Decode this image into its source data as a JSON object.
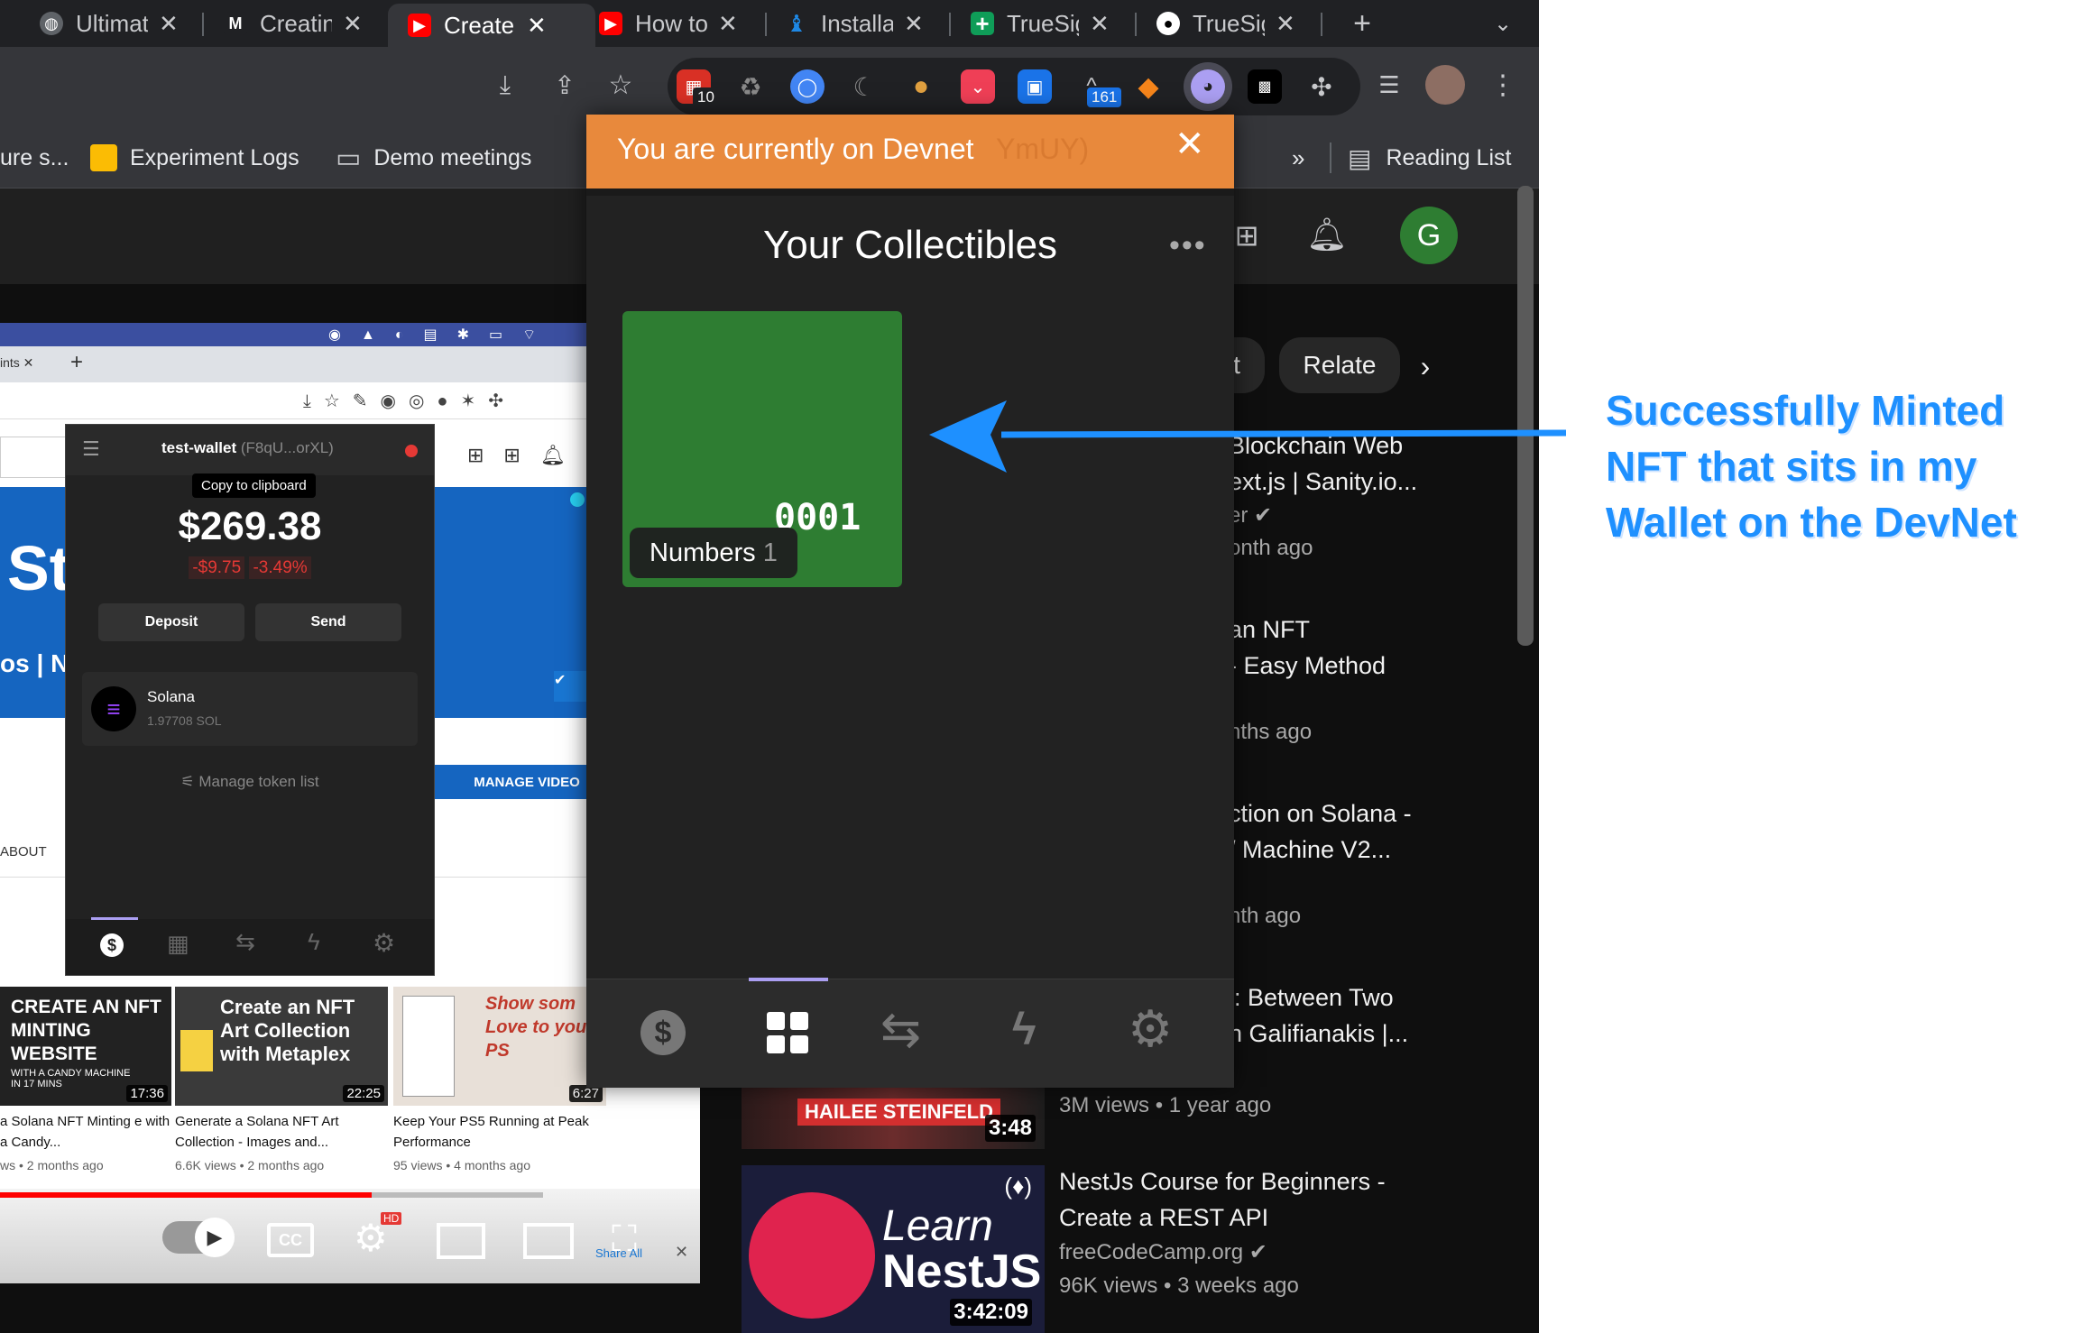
{
  "tabs": [
    {
      "label": "Ultimat",
      "icon": "globe-icon",
      "color": "#5f6368"
    },
    {
      "label": "Creatin",
      "icon": "medium-logo-icon",
      "color": "#000000"
    },
    {
      "label": "Create",
      "icon": "youtube-icon",
      "color": "#ff0000",
      "active": true
    },
    {
      "label": "How to",
      "icon": "youtube-icon",
      "color": "#ff0000"
    },
    {
      "label": "Installa",
      "icon": "candy-machine-icon",
      "color": "#1e88e5"
    },
    {
      "label": "TrueSig",
      "icon": "sheets-plus-icon",
      "color": "#0f9d58"
    },
    {
      "label": "TrueSig",
      "icon": "github-icon",
      "color": "#000000"
    }
  ],
  "extensions": {
    "calendar_badge": "10",
    "notes_badge": "161"
  },
  "bookmarks": {
    "truncated_left": "ure s...",
    "items": [
      "Experiment Logs",
      "Demo meetings"
    ],
    "overflow": "»",
    "reading_list": "Reading List"
  },
  "youtube": {
    "avatar_letter": "G",
    "chips": [
      "t",
      "Relate"
    ],
    "sidebar": [
      {
        "line1": "Blockchain Web",
        "line2": "ext.js | Sanity.io...",
        "channel": "er",
        "meta": "onth ago"
      },
      {
        "line1": "an NFT",
        "line2": "- Easy Method",
        "channel": "",
        "meta": "nths ago"
      },
      {
        "line1": "ction on Solana -",
        "line2": "/ Machine V2...",
        "channel": "",
        "meta": "nth ago"
      },
      {
        "line1": "l: Between Two",
        "line2": "n Galifianakis |...",
        "channel": "",
        "meta": "3M views • 1 year ago"
      },
      {
        "line1": "NestJs Course for Beginners -",
        "line2": "Create a REST API",
        "channel": "freeCodeCamp.org",
        "meta": "96K views • 3 weeks ago"
      }
    ],
    "thumb_hailee": {
      "text": "HAILEE STEINFELD",
      "duration": "3:48"
    },
    "thumb_nest": {
      "learn": "Learn",
      "title": "NestJS",
      "duration": "3:42:09"
    }
  },
  "inner": {
    "tab_text": "ints",
    "manage_video": "MANAGE VIDEO",
    "about": "ABOUT",
    "title_letters": "St",
    "sub_letters": "os | N",
    "thumbs": [
      {
        "title": "CREATE AN NFT MINTING WEBSITE",
        "sub": "WITH A CANDY MACHINE IN 17 MINS",
        "duration": "17:36",
        "caption": "a Solana NFT Minting e with a Candy...",
        "meta": "ws • 2 months ago"
      },
      {
        "title": "Create an NFT Art Collection with Metaplex",
        "sub": "",
        "duration": "22:25",
        "caption": "Generate a Solana NFT Art Collection - Images and...",
        "meta": "6.6K views • 2 months ago"
      },
      {
        "title": "Show som Love to your PS",
        "sub": "",
        "duration": "6:27",
        "caption": "Keep Your PS5 Running at Peak Performance",
        "meta": "95 views • 4 months ago"
      }
    ],
    "player_share": "Share All"
  },
  "small_wallet": {
    "name": "test-wallet",
    "address": "(F8qU...orXL)",
    "tooltip": "Copy to clipboard",
    "balance": "$269.38",
    "change_abs": "-$9.75",
    "change_pct": "-3.49%",
    "deposit": "Deposit",
    "send": "Send",
    "token_name": "Solana",
    "token_amount": "1.97708 SOL",
    "manage": "Manage token list"
  },
  "wallet": {
    "banner": "You are currently on Devnet",
    "banner_ghost": "YmUY)",
    "heading": "Your Collectibles",
    "nft_number": "0001",
    "nft_label": "Numbers",
    "nft_count": "1",
    "colors": {
      "banner": "#e8893c",
      "nft": "#2e7d32",
      "bg": "#222222"
    }
  },
  "annotation": [
    "Successfully Minted",
    "NFT that sits in my",
    "Wallet on the DevNet"
  ]
}
